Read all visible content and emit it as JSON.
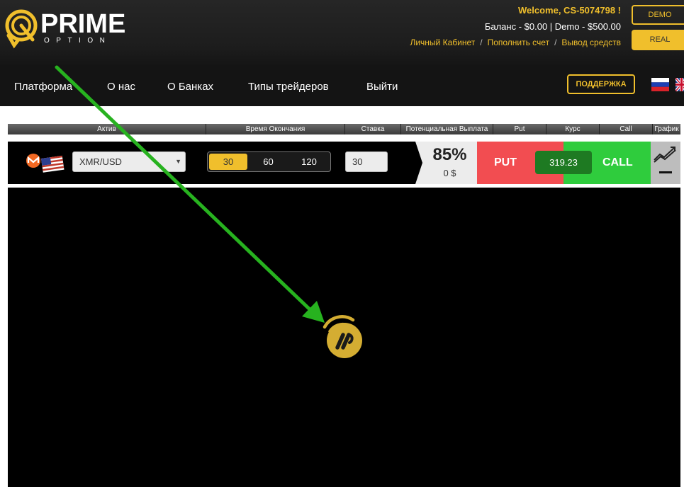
{
  "brand": {
    "name": "PRIME",
    "sub": "OPTION"
  },
  "account": {
    "welcome": "Welcome, CS-5074798 !",
    "balance": "Баланс  - $0.00 | Demo - $500.00",
    "links": [
      "Личный Кабинет",
      "Пополнить счет",
      "Вывод средств"
    ],
    "demo_label": "DEMO",
    "real_label": "REAL"
  },
  "nav": {
    "items": [
      "Платформа",
      "О нас",
      "О Банках",
      "Типы трейдеров",
      "Выйти"
    ],
    "support_label": "ПОДДЕРЖКА"
  },
  "columns": [
    "Актив",
    "Время Окончания",
    "Ставка",
    "Потенциальная Выплата",
    "Put",
    "Курс",
    "Call",
    "График"
  ],
  "trade": {
    "asset": "XMR/USD",
    "times": [
      "30",
      "60",
      "120"
    ],
    "selected_time": "30",
    "stake": "30",
    "payout_pct": "85%",
    "payout_amount": "0 $",
    "put_label": "PUT",
    "rate": "319.23",
    "call_label": "CALL"
  },
  "colors": {
    "accent": "#f0bf2c",
    "put": "#f24d51",
    "call": "#2fcc3d",
    "rate_bg": "#1e7a22",
    "annotation_arrow": "#27b21f"
  }
}
